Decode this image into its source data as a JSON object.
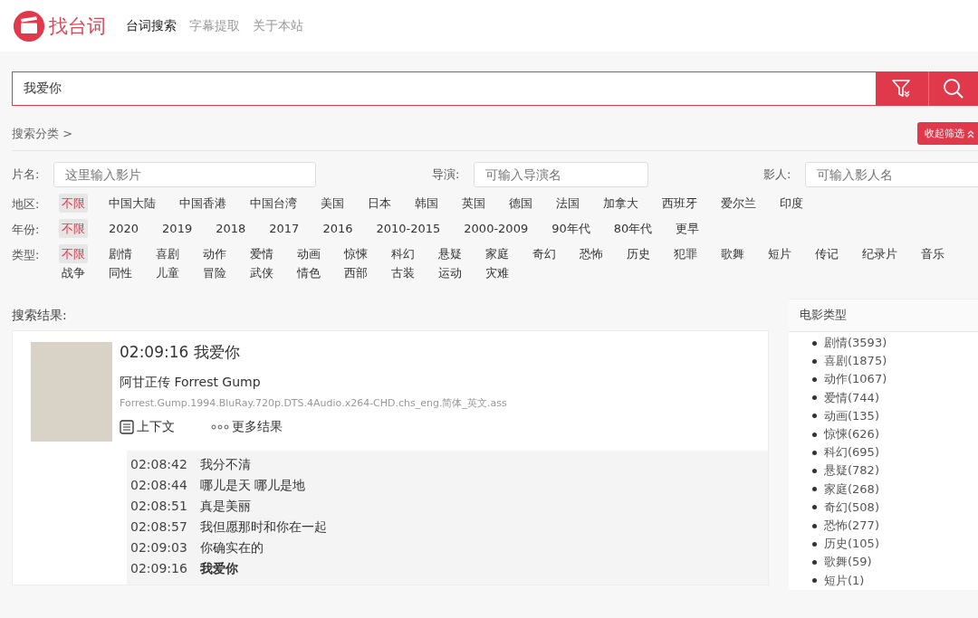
{
  "header": {
    "logo_text": "找台词",
    "nav": [
      {
        "label": "台词搜索",
        "selected": true
      },
      {
        "label": "字幕提取",
        "selected": false
      },
      {
        "label": "关于本站",
        "selected": false
      }
    ]
  },
  "search": {
    "value": "我爱你"
  },
  "category": {
    "label": "搜索分类 >",
    "collapse_button": "收起筛选"
  },
  "fields": [
    {
      "label": "片名:",
      "placeholder": "这里输入影片"
    },
    {
      "label": "导演:",
      "placeholder": "可输入导演名"
    },
    {
      "label": "影人:",
      "placeholder": "可输入影人名"
    }
  ],
  "filters": [
    {
      "label": "地区:",
      "options": [
        {
          "label": "不限",
          "selected": true
        },
        {
          "label": "中国大陆",
          "selected": false
        },
        {
          "label": "中国香港",
          "selected": false
        },
        {
          "label": "中国台湾",
          "selected": false
        },
        {
          "label": "美国",
          "selected": false
        },
        {
          "label": "日本",
          "selected": false
        },
        {
          "label": "韩国",
          "selected": false
        },
        {
          "label": "英国",
          "selected": false
        },
        {
          "label": "德国",
          "selected": false
        },
        {
          "label": "法国",
          "selected": false
        },
        {
          "label": "加拿大",
          "selected": false
        },
        {
          "label": "西班牙",
          "selected": false
        },
        {
          "label": "爱尔兰",
          "selected": false
        },
        {
          "label": "印度",
          "selected": false
        }
      ]
    },
    {
      "label": "年份:",
      "options": [
        {
          "label": "不限",
          "selected": true
        },
        {
          "label": "2020",
          "selected": false
        },
        {
          "label": "2019",
          "selected": false
        },
        {
          "label": "2018",
          "selected": false
        },
        {
          "label": "2017",
          "selected": false
        },
        {
          "label": "2016",
          "selected": false
        },
        {
          "label": "2010-2015",
          "selected": false
        },
        {
          "label": "2000-2009",
          "selected": false
        },
        {
          "label": "90年代",
          "selected": false
        },
        {
          "label": "80年代",
          "selected": false
        },
        {
          "label": "更早",
          "selected": false
        }
      ]
    },
    {
      "label": "类型:",
      "options": [
        {
          "label": "不限",
          "selected": true
        },
        {
          "label": "剧情",
          "selected": false
        },
        {
          "label": "喜剧",
          "selected": false
        },
        {
          "label": "动作",
          "selected": false
        },
        {
          "label": "爱情",
          "selected": false
        },
        {
          "label": "动画",
          "selected": false
        },
        {
          "label": "惊悚",
          "selected": false
        },
        {
          "label": "科幻",
          "selected": false
        },
        {
          "label": "悬疑",
          "selected": false
        },
        {
          "label": "家庭",
          "selected": false
        },
        {
          "label": "奇幻",
          "selected": false
        },
        {
          "label": "恐怖",
          "selected": false
        },
        {
          "label": "历史",
          "selected": false
        },
        {
          "label": "犯罪",
          "selected": false
        },
        {
          "label": "歌舞",
          "selected": false
        },
        {
          "label": "短片",
          "selected": false
        },
        {
          "label": "传记",
          "selected": false
        },
        {
          "label": "纪录片",
          "selected": false
        },
        {
          "label": "音乐",
          "selected": false
        },
        {
          "label": "战争",
          "selected": false
        },
        {
          "label": "同性",
          "selected": false
        },
        {
          "label": "儿童",
          "selected": false
        },
        {
          "label": "冒险",
          "selected": false
        },
        {
          "label": "武侠",
          "selected": false
        },
        {
          "label": "情色",
          "selected": false
        },
        {
          "label": "西部",
          "selected": false
        },
        {
          "label": "古装",
          "selected": false
        },
        {
          "label": "运动",
          "selected": false
        },
        {
          "label": "灾难",
          "selected": false
        }
      ]
    }
  ],
  "results": {
    "heading": "搜索结果:",
    "items": [
      {
        "title": "02:09:16 我爱你",
        "movie": "阿甘正传 Forrest Gump",
        "file": "Forrest.Gump.1994.BluRay.720p.DTS.4Audio.x264-CHD.chs_eng.简体_英文.ass",
        "context_button": "上下文",
        "more_button": "更多结果",
        "subtitles": [
          {
            "time": "02:08:42",
            "text": "我分不清",
            "current": false
          },
          {
            "time": "02:08:44",
            "text": "哪儿是天 哪儿是地",
            "current": false
          },
          {
            "time": "02:08:51",
            "text": "真是美丽",
            "current": false
          },
          {
            "time": "02:08:57",
            "text": "我但愿那时和你在一起",
            "current": false
          },
          {
            "time": "02:09:03",
            "text": "你确实在的",
            "current": false
          },
          {
            "time": "02:09:16",
            "text": "我爱你",
            "current": true
          }
        ]
      }
    ]
  },
  "sidebar": {
    "title": "电影类型",
    "items": [
      "剧情(3593)",
      "喜剧(1875)",
      "动作(1067)",
      "爱情(744)",
      "动画(135)",
      "惊悚(626)",
      "科幻(695)",
      "悬疑(782)",
      "家庭(268)",
      "奇幻(508)",
      "恐怖(277)",
      "历史(105)",
      "歌舞(59)",
      "短片(1)"
    ]
  }
}
